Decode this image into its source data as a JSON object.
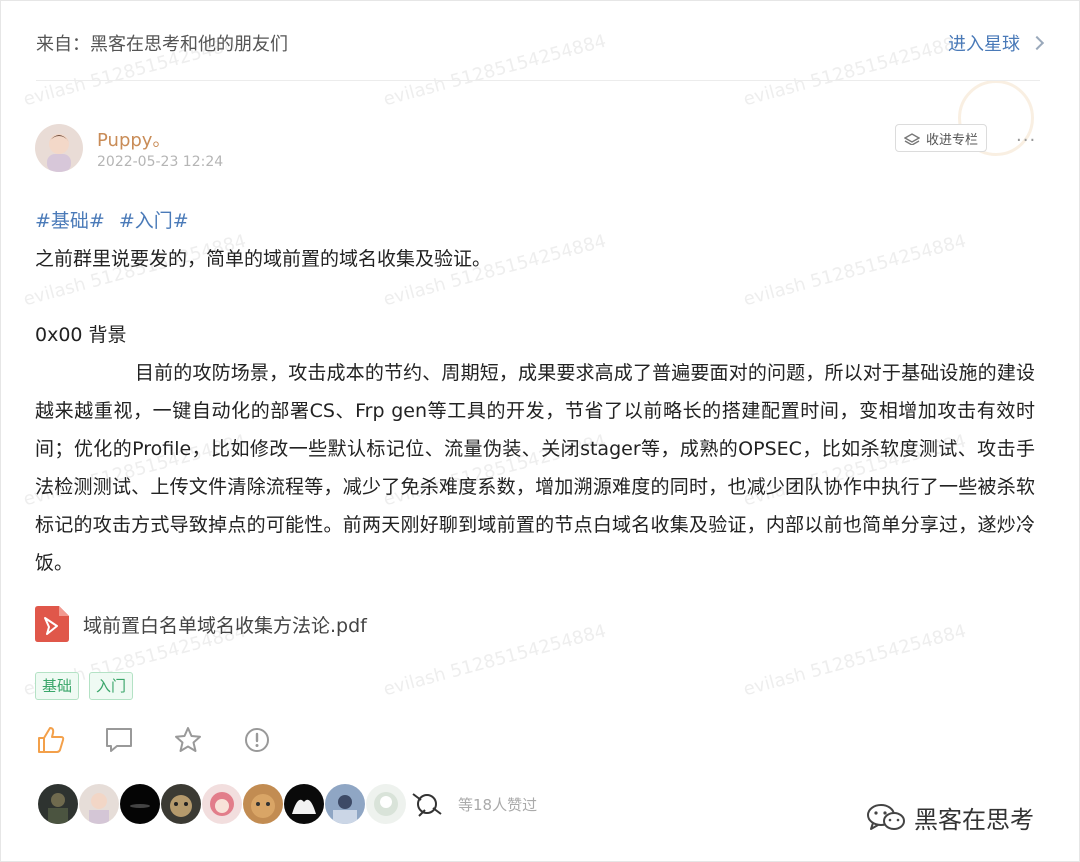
{
  "header": {
    "from_label": "来自：黑客在思考和他的朋友们",
    "enter_label": "进入星球"
  },
  "post": {
    "author": "Puppy。",
    "date": "2022-05-23 12:24",
    "collect_label": "收进专栏",
    "more_label": "···",
    "topic_tags": [
      "#基础#",
      "#入门#"
    ],
    "intro": "之前群里说要发的，简单的域前置的域名收集及验证。",
    "section_title": "0x00 背景",
    "paragraph": "目前的攻防场景，攻击成本的节约、周期短，成果要求高成了普遍要面对的问题，所以对于基础设施的建设越来越重视，一键自动化的部署CS、Frp gen等工具的开发，节省了以前略长的搭建配置时间，变相增加攻击有效时间；优化的Profile，比如修改一些默认标记位、流量伪装、关闭stager等，成熟的OPSEC，比如杀软度测试、攻击手法检测测试、上传文件清除流程等，减少了免杀难度系数，增加溯源难度的同时，也减少团队协作中执行了一些被杀软标记的攻击方式导致掉点的可能性。前两天刚好聊到域前置的节点白域名收集及验证，内部以前也简单分享过，遂炒冷饭。",
    "attachment": "域前置白名单域名收集方法论.pdf",
    "chips": [
      "基础",
      "入门"
    ],
    "likes_label": "等18人赞过"
  },
  "footer": {
    "brand": "黑客在思考"
  },
  "watermark": "evilash 51285154254884",
  "colors": {
    "link": "#4a7ab8",
    "author": "#c98c57",
    "chip": "#3aa66a",
    "like_active": "#f3a04a",
    "pdf": "#e0574a"
  }
}
